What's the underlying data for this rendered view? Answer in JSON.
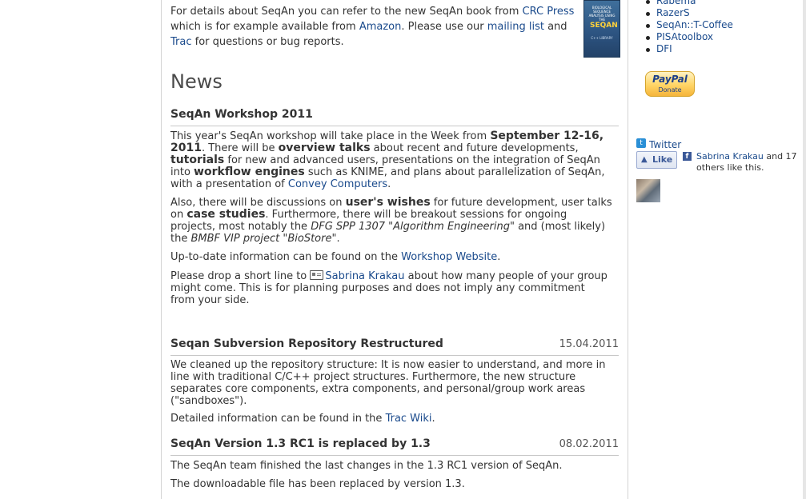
{
  "intro": {
    "t1": "For details about SeqAn you can refer to the new SeqAn book from ",
    "l1": "CRC Press",
    "t2": " which is for example available from ",
    "l2": "Amazon",
    "t3": ". Please use our ",
    "l3": "mailing list",
    "t4": " and ",
    "l4": "Trac",
    "t5": " for questions or bug reports."
  },
  "book": {
    "line1": "BIOLOGICAL SEQUENCE ANALYSIS USING THE",
    "logo": "SEQAN",
    "line2": "C++ LIBRARY"
  },
  "news": {
    "title": "News",
    "workshop": {
      "heading": "SeqAn Workshop 2011",
      "p1": {
        "a": "This year's SeqAn workshop will take place in the Week from ",
        "b1": "September 12-16, 2011",
        "c": ". There will be ",
        "b2": "overview talks",
        "d": " about recent and future developments, ",
        "b3": "tutorials",
        "e": " for new and advanced users, presentations on the integration of SeqAn into ",
        "b4": "workflow engines",
        "f": " such as KNIME, and plans about parallelization of SeqAn, with a presentation of ",
        "link": "Convey Computers",
        "g": "."
      },
      "p2": {
        "a": "Also, there will be discussions on ",
        "b1": "user's wishes",
        "c": " for future development, user talks on ",
        "b2": "case studies",
        "d": ". Furthermore, there will be breakout sessions for ongoing projects, most notably the ",
        "i1": "DFG SPP 1307 \"Algorithm Engineering\"",
        "e": " and (most likely) the ",
        "i2": "BMBF VIP project \"BioStore\"",
        "f": "."
      },
      "p3": {
        "a": "Up-to-date information can be found on the ",
        "link": "Workshop Website",
        "b": "."
      },
      "p4": {
        "a": "Please drop a short line to ",
        "link": "Sabrina Krakau",
        "b": " about how many people of your group might come. This is for planning purposes and does not imply any commitment from your side."
      }
    },
    "svn": {
      "heading": "Seqan Subversion Repository Restructured",
      "date": "15.04.2011",
      "p1": "We cleaned up the repository structure: It is now easier to understand, and more in line with traditional C/C++ project structures. Furthermore, the new structure separates core components, extra components, and personal/group work areas (\"sandboxes\").",
      "p2a": "Detailed information can be found in the ",
      "p2link": "Trac Wiki",
      "p2b": "."
    },
    "release": {
      "heading": "SeqAn Version 1.3 RC1 is replaced by 1.3",
      "date": "08.02.2011",
      "p1": "The SeqAn team finished the last changes in the 1.3 RC1 version of SeqAn.",
      "p2": "The downloadable file has been replaced by version 1.3."
    }
  },
  "sidebar": {
    "links": [
      "Rabema",
      "RazerS",
      "SeqAn::T-Coffee",
      "PISAtoolbox",
      "DFI"
    ],
    "paypal": {
      "brand": "PayPal",
      "label": "Donate"
    },
    "twitter": "Twitter",
    "like": "Like",
    "fb": {
      "name": "Sabrina Krakau",
      "rest": " and 17 others like this."
    }
  }
}
